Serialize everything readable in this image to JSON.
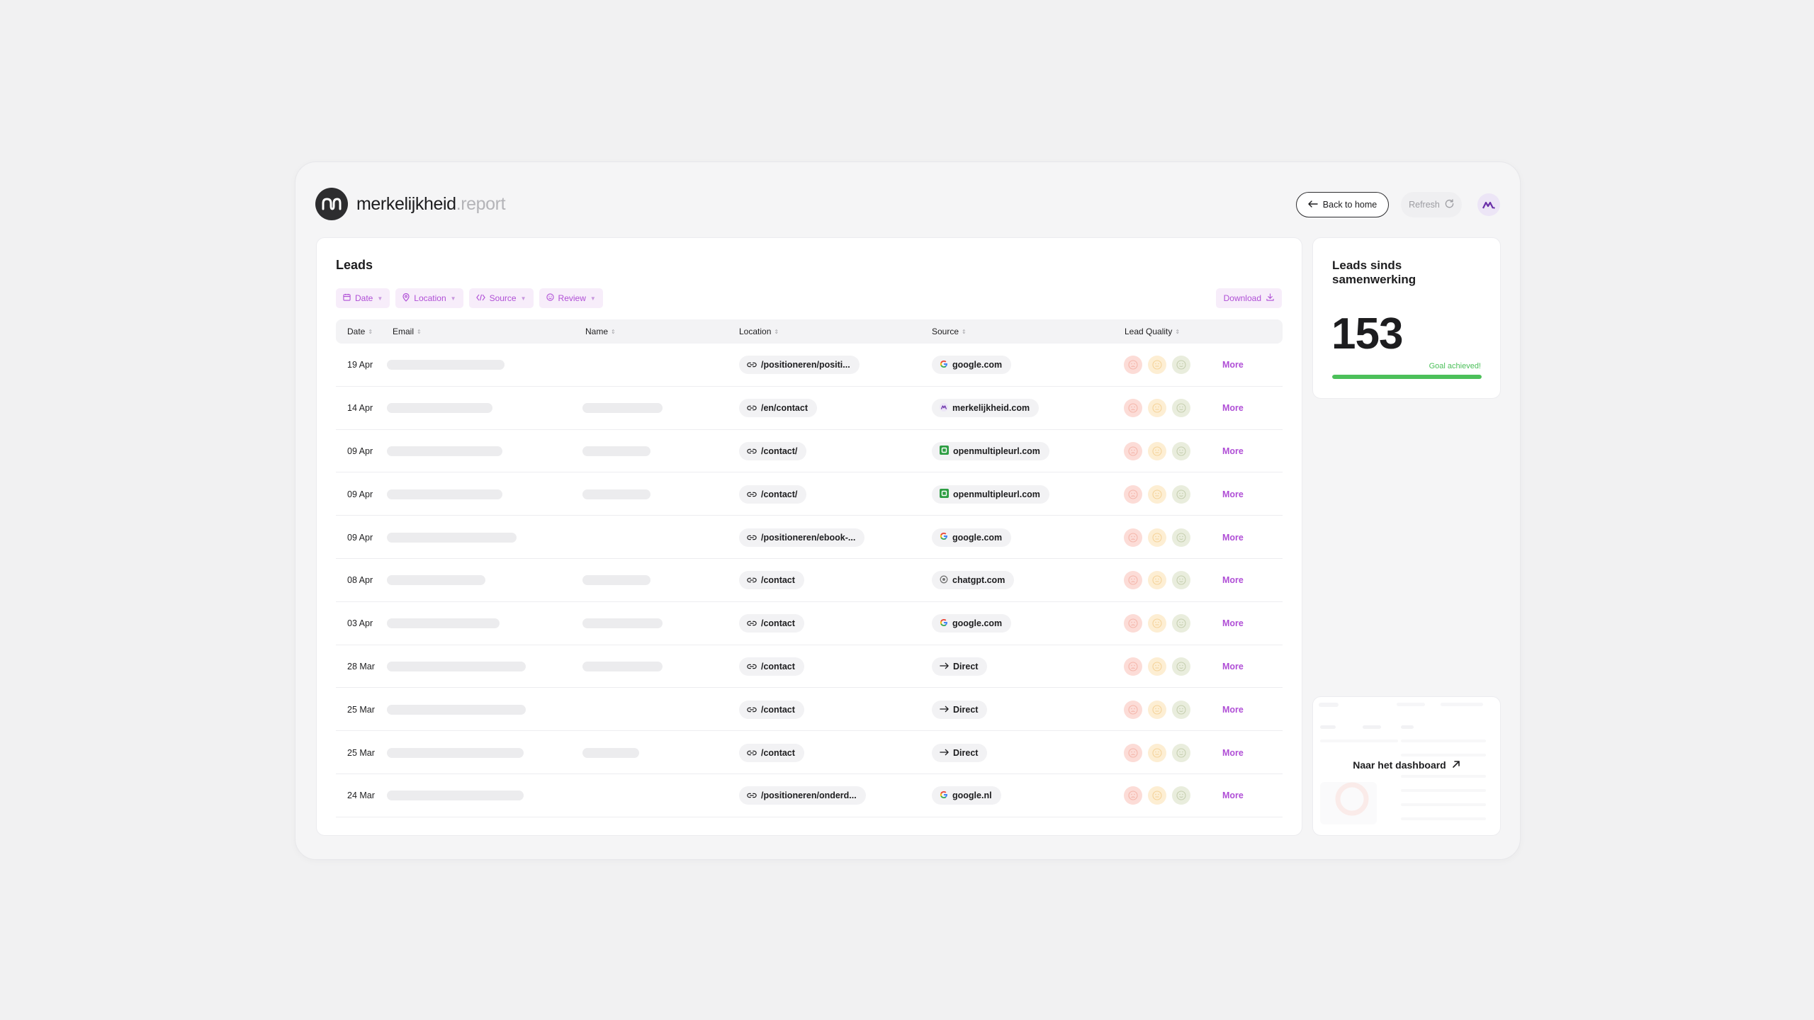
{
  "brand": {
    "name": "merkelijkheid",
    "suffix": ".report"
  },
  "header": {
    "back_label": "Back to home",
    "refresh_label": "Refresh"
  },
  "leads": {
    "title": "Leads",
    "filters": [
      {
        "label": "Date",
        "icon": "calendar-icon"
      },
      {
        "label": "Location",
        "icon": "pin-icon"
      },
      {
        "label": "Source",
        "icon": "code-icon"
      },
      {
        "label": "Review",
        "icon": "smiley-icon"
      }
    ],
    "download_label": "Download",
    "columns": [
      "Date",
      "Email",
      "Name",
      "Location",
      "Source",
      "Lead Quality"
    ],
    "rows": [
      {
        "date": "19 Apr",
        "email_len": 100,
        "name_len": 0,
        "location": "/positioneren/positi...",
        "source": "google.com",
        "source_icon": "google",
        "more": "More"
      },
      {
        "date": "14 Apr",
        "email_len": 90,
        "name_len": 68,
        "location": "/en/contact",
        "source": "merkelijkheid.com",
        "source_icon": "brand",
        "more": "More"
      },
      {
        "date": "09 Apr",
        "email_len": 98,
        "name_len": 58,
        "location": "/contact/",
        "source": "openmultipleurl.com",
        "source_icon": "green",
        "more": "More"
      },
      {
        "date": "09 Apr",
        "email_len": 98,
        "name_len": 58,
        "location": "/contact/",
        "source": "openmultipleurl.com",
        "source_icon": "green",
        "more": "More"
      },
      {
        "date": "09 Apr",
        "email_len": 110,
        "name_len": 0,
        "location": "/positioneren/ebook-...",
        "source": "google.com",
        "source_icon": "google",
        "more": "More"
      },
      {
        "date": "08 Apr",
        "email_len": 84,
        "name_len": 58,
        "location": "/contact",
        "source": "chatgpt.com",
        "source_icon": "chatgpt",
        "more": "More"
      },
      {
        "date": "03 Apr",
        "email_len": 96,
        "name_len": 68,
        "location": "/contact",
        "source": "google.com",
        "source_icon": "google",
        "more": "More"
      },
      {
        "date": "28 Mar",
        "email_len": 118,
        "name_len": 68,
        "location": "/contact",
        "source": "Direct",
        "source_icon": "arrow",
        "more": "More"
      },
      {
        "date": "25 Mar",
        "email_len": 118,
        "name_len": 0,
        "location": "/contact",
        "source": "Direct",
        "source_icon": "arrow",
        "more": "More"
      },
      {
        "date": "25 Mar",
        "email_len": 116,
        "name_len": 48,
        "location": "/contact",
        "source": "Direct",
        "source_icon": "arrow",
        "more": "More"
      },
      {
        "date": "24 Mar",
        "email_len": 116,
        "name_len": 0,
        "location": "/positioneren/onderd...",
        "source": "google.nl",
        "source_icon": "google",
        "more": "More"
      }
    ]
  },
  "stats": {
    "title": "Leads sinds samenwerking",
    "value": "153",
    "goal_label": "Goal achieved!",
    "progress": 1.0
  },
  "dashboard_link": {
    "label": "Naar het dashboard"
  },
  "colors": {
    "accent": "#b04fd6",
    "success": "#4cc05a"
  }
}
